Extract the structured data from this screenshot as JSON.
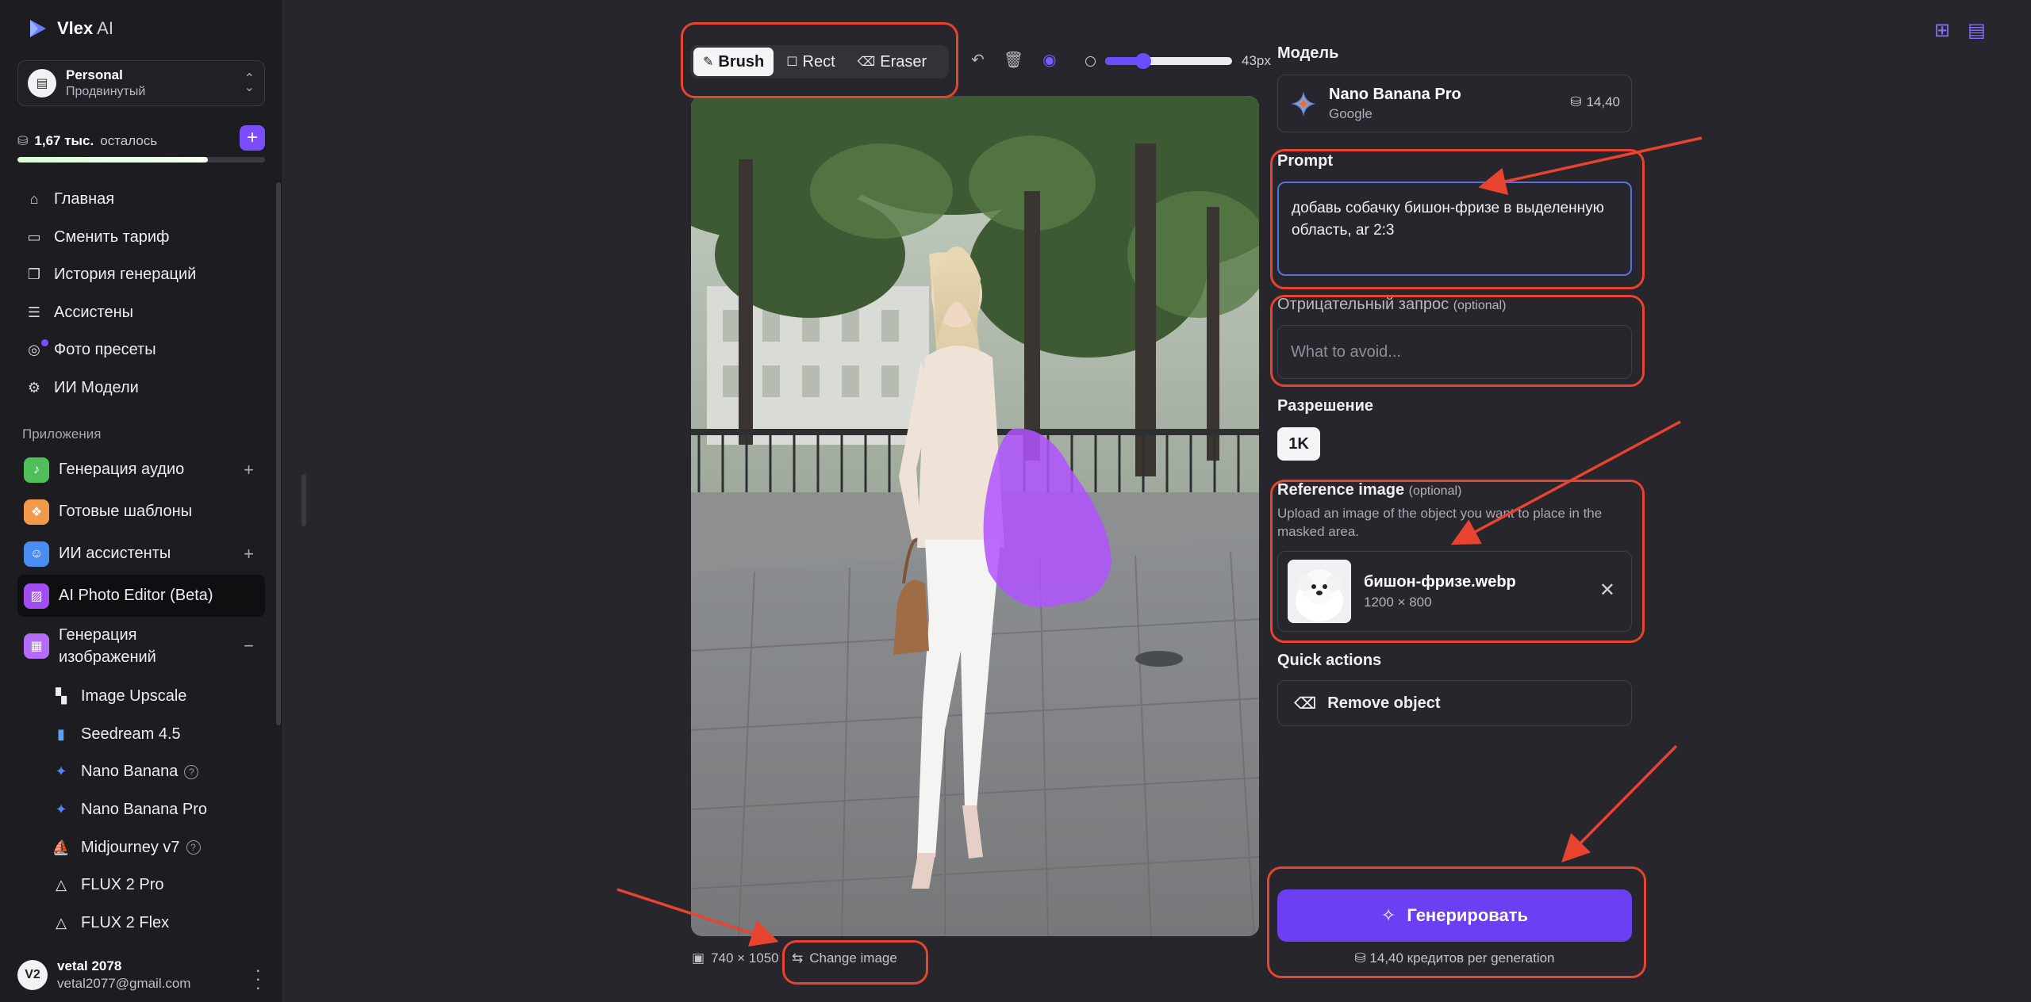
{
  "app": {
    "name": "Vlex",
    "name_suffix": " AI"
  },
  "workspace": {
    "title": "Personal",
    "subtitle": "Продвинутый"
  },
  "credits": {
    "amount": "1,67 тыс.",
    "label": "осталось",
    "progress": 0.77
  },
  "nav": [
    {
      "label": "Главная",
      "icon": "home-icon"
    },
    {
      "label": "Сменить тариф",
      "icon": "card-icon"
    },
    {
      "label": "История генераций",
      "icon": "history-icon"
    },
    {
      "label": "Ассистены",
      "icon": "chat-icon"
    },
    {
      "label": "Фото пресеты",
      "icon": "camera-icon"
    },
    {
      "label": "ИИ Модели",
      "icon": "chip-icon"
    }
  ],
  "apps_section": "Приложения",
  "apps": [
    {
      "label": "Генерация аудио",
      "icon": "audio-icon",
      "color": "#4fbf5a",
      "suffix": "+"
    },
    {
      "label": "Готовые шаблоны",
      "icon": "template-icon",
      "color": "#f2994a",
      "suffix": ""
    },
    {
      "label": "ИИ ассистенты",
      "icon": "assistant-icon",
      "color": "#4a8df2",
      "suffix": "+"
    },
    {
      "label": "AI Photo Editor (Beta)",
      "icon": "photo-editor-icon",
      "color": "#a24df2",
      "suffix": ""
    },
    {
      "label": "Генерация изображений",
      "icon": "image-gen-icon",
      "color": "#b56cf5",
      "suffix": "−"
    }
  ],
  "sub_apps": [
    {
      "label": "Image Upscale",
      "icon": "upscale-icon",
      "help": false
    },
    {
      "label": "Seedream 4.5",
      "icon": "seedream-icon",
      "help": false
    },
    {
      "label": "Nano Banana",
      "icon": "sparkle-icon",
      "help": true
    },
    {
      "label": "Nano Banana Pro",
      "icon": "sparkle-icon",
      "help": false
    },
    {
      "label": "Midjourney v7",
      "icon": "midjourney-icon",
      "help": true
    },
    {
      "label": "FLUX 2 Pro",
      "icon": "flux-icon",
      "help": false
    },
    {
      "label": "FLUX 2 Flex",
      "icon": "flux-icon",
      "help": false
    }
  ],
  "user": {
    "initials": "V2",
    "name": "vetal 2078",
    "email": "vetal2077@gmail.com"
  },
  "toolbar": {
    "brush": "Brush",
    "rect": "Rect",
    "eraser": "Eraser",
    "brush_size": "43px",
    "brush_size_fraction": 0.3
  },
  "image": {
    "dimensions": "740 × 1050",
    "change_label": "Change image"
  },
  "model": {
    "section": "Модель",
    "name": "Nano Banana Pro",
    "provider": "Google",
    "cost": "14,40"
  },
  "prompt": {
    "label": "Prompt",
    "value": "добавь собачку бишон-фризе в выделенную область, ar 2:3"
  },
  "negative": {
    "label": "Отрицательный запрос",
    "optional": "(optional)",
    "placeholder": "What to avoid..."
  },
  "resolution": {
    "label": "Разрешение",
    "value": "1K"
  },
  "reference": {
    "label": "Reference image",
    "optional": "(optional)",
    "description": "Upload an image of the object you want to place in the masked area.",
    "file_name": "бишон-фризе.webp",
    "file_size": "1200 × 800"
  },
  "quick_actions": {
    "label": "Quick actions",
    "remove_object": "Remove object"
  },
  "generate": {
    "label": "Генерировать",
    "note": "14,40 кредитов per generation"
  },
  "colors": {
    "accent": "#6d3ff2",
    "annotation": "#e8432e",
    "mask": "#b054ff"
  }
}
